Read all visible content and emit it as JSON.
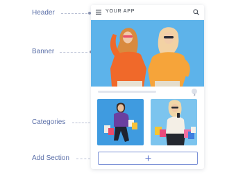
{
  "annotations": {
    "header": "Header",
    "banner": "Banner",
    "categories": "Categories",
    "add_section": "Add Section"
  },
  "app": {
    "title": "YOUR APP"
  },
  "icons": {
    "menu": "menu-icon",
    "search": "search-icon",
    "add": "plus-icon",
    "arrow": "chevron-right-icon"
  },
  "colors": {
    "label_text": "#5b6fa8",
    "add_section_label": "#4a63c8",
    "banner_bg": "#5fb4ea",
    "category_1_bg": "#3f9be0",
    "category_2_bg": "#7cc4ee",
    "add_border": "#7a90d6"
  }
}
